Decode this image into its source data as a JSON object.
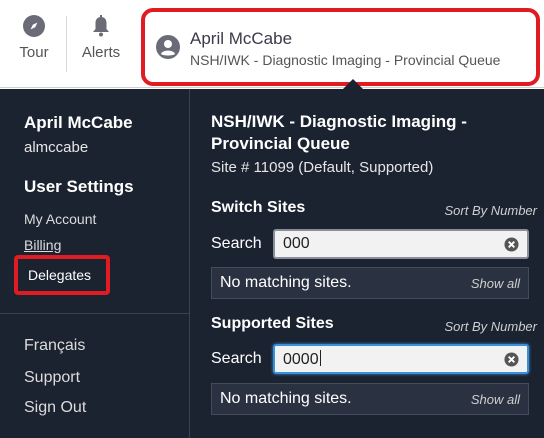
{
  "topbar": {
    "tour_label": "Tour",
    "alerts_label": "Alerts",
    "profile": {
      "name": "April McCabe",
      "queue": "NSH/IWK - Diagnostic Imaging - Provincial Queue"
    }
  },
  "user_menu": {
    "name": "April McCabe",
    "username": "almccabe",
    "settings_heading": "User Settings",
    "items": [
      "My Account",
      "Billing",
      "Delegates"
    ],
    "language": "Français",
    "support": "Support",
    "sign_out": "Sign Out"
  },
  "site_panel": {
    "title": "NSH/IWK - Diagnostic Imaging - Provincial Queue",
    "site_number": "Site # 11099 (Default, Supported)",
    "switch_sites": {
      "heading": "Switch Sites",
      "sort_label": "Sort By Number",
      "search_label": "Search",
      "search_value": "000",
      "result_message": "No matching sites.",
      "show_all": "Show all"
    },
    "supported_sites": {
      "heading": "Supported Sites",
      "sort_label": "Sort By Number",
      "search_label": "Search",
      "search_value": "0000",
      "result_message": "No matching sites.",
      "show_all": "Show all"
    }
  },
  "colors": {
    "panel_bg": "#1b2230",
    "highlight_red": "#e11b22",
    "focus_blue": "#3b8fd6"
  },
  "icons": [
    "compass-icon",
    "bell-icon",
    "user-circle-icon",
    "clear-icon"
  ]
}
